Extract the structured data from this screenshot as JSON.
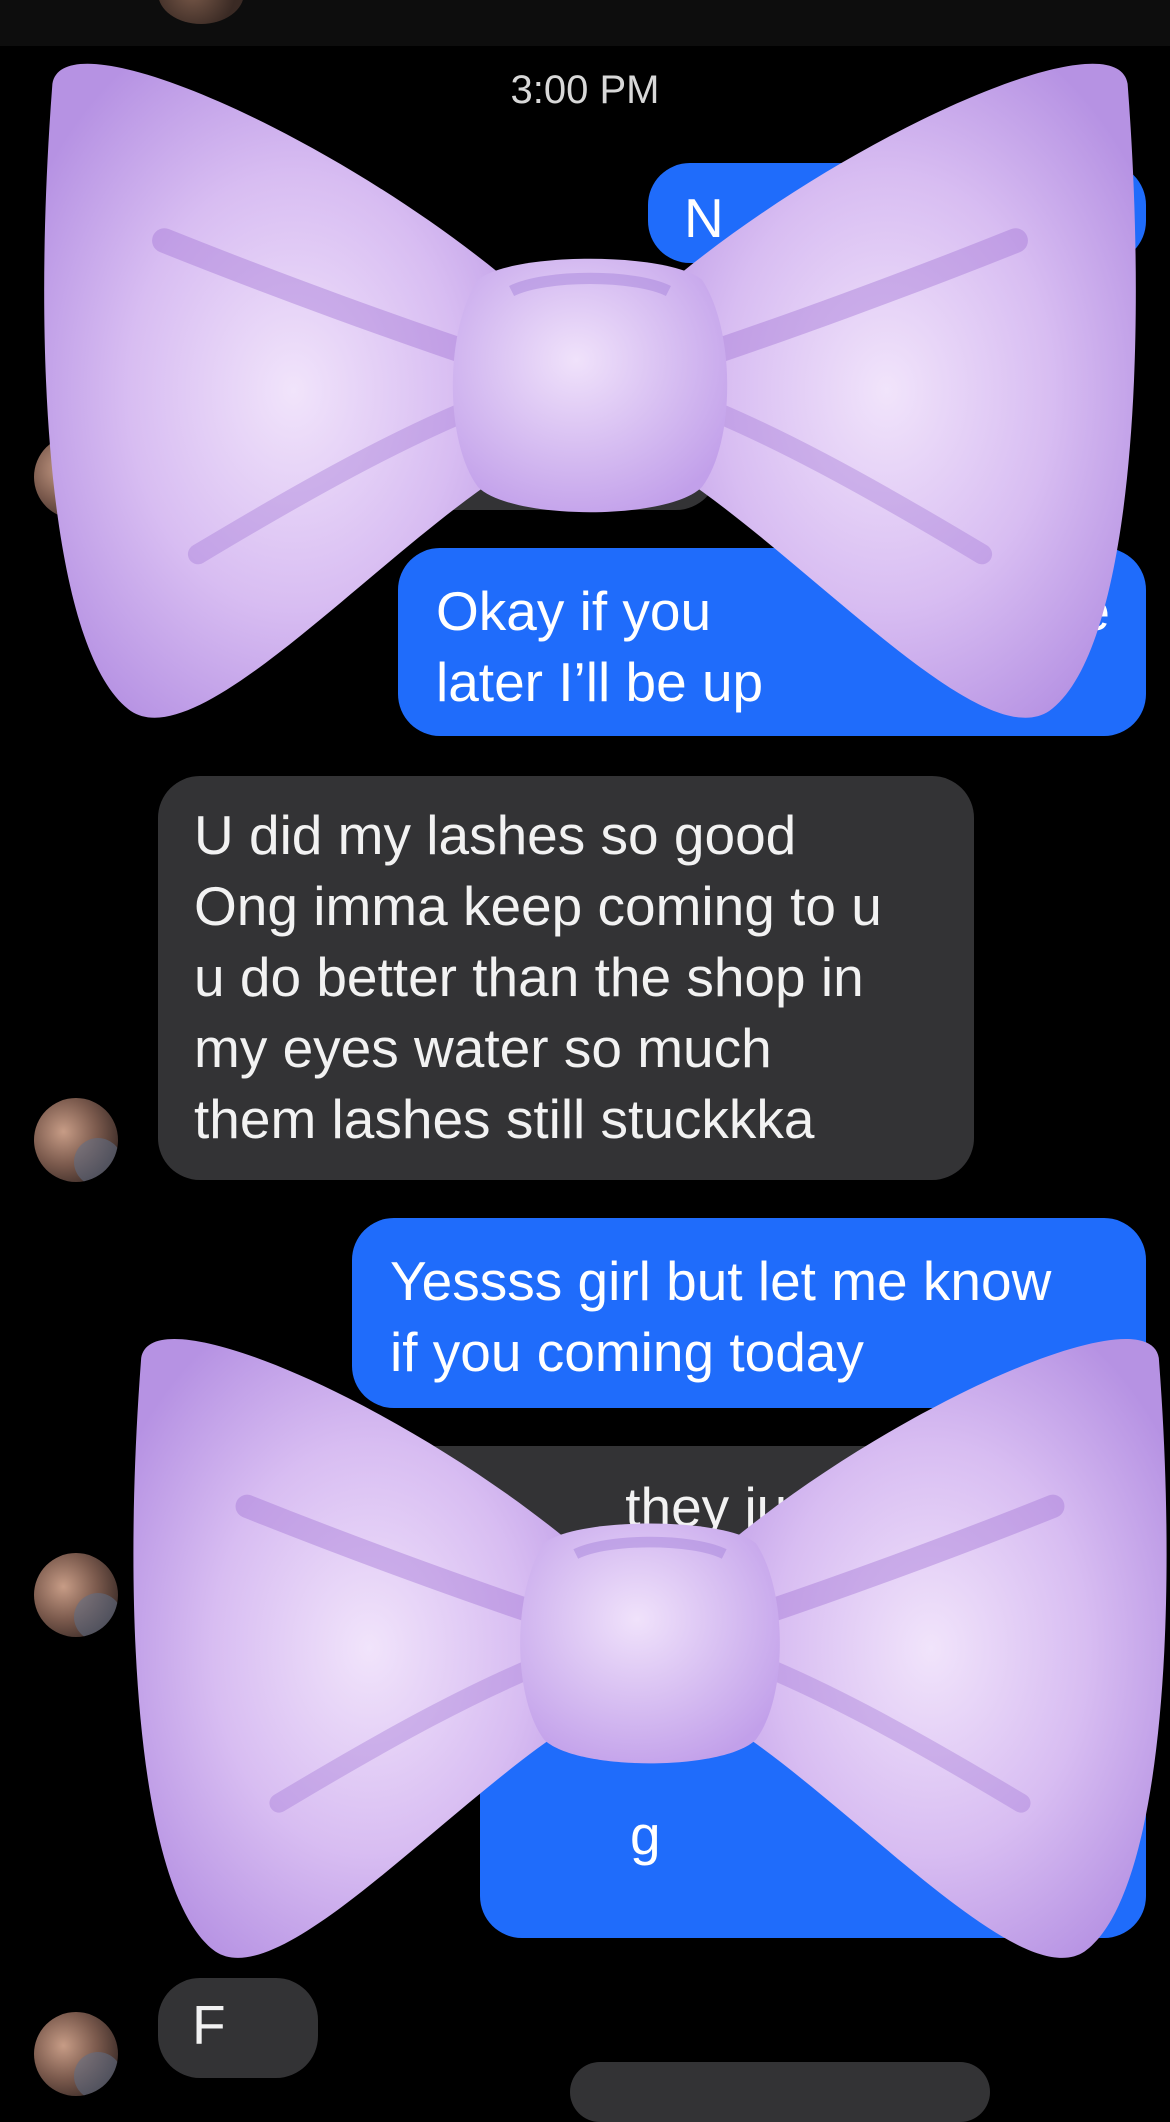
{
  "header": {
    "time": "3:00 PM"
  },
  "messages": {
    "m1": {
      "text": "N"
    },
    "m3": {
      "line1": "Okay if you",
      "line1_tail": "e",
      "line2": "later I’ll be up"
    },
    "m4": {
      "lines": [
        "U did my lashes so good",
        "Ong imma keep coming to u",
        "u do better than the shop in",
        "my eyes water so much",
        "them lashes still stuckkka"
      ]
    },
    "m5": {
      "line1": "Yessss girl but let me know",
      "line2": "if you coming today"
    },
    "m6": {
      "text": "they just told"
    },
    "m7": {
      "text": "g"
    },
    "m8": {
      "text": "F"
    }
  },
  "stickers": {
    "bow": "purple-bow-sticker"
  },
  "colors": {
    "outgoing": "#1f6cfb",
    "incoming": "#333335",
    "background": "#000000",
    "bow": "#c9a9ec"
  }
}
